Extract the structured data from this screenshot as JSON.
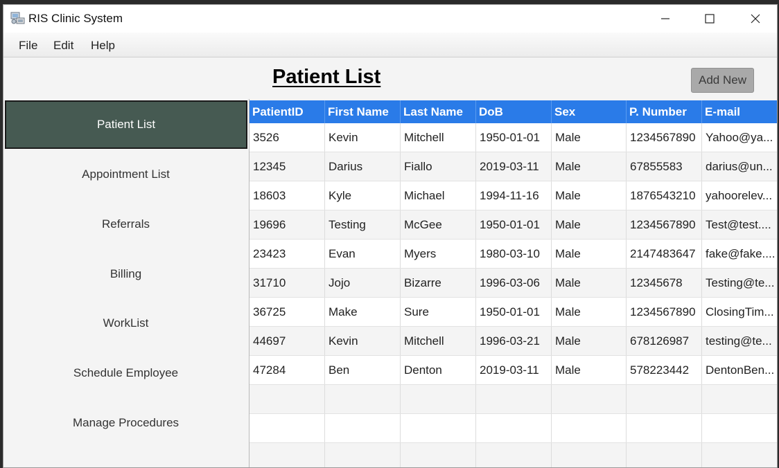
{
  "window": {
    "title": "RIS Clinic System",
    "icon": "clinic-app-icon"
  },
  "menu": {
    "file": "File",
    "edit": "Edit",
    "help": "Help"
  },
  "header": {
    "title": "Patient List",
    "add_new_label": "Add New"
  },
  "sidebar": {
    "items": [
      {
        "label": "Patient List",
        "active": true
      },
      {
        "label": "Appointment List",
        "active": false
      },
      {
        "label": "Referrals",
        "active": false
      },
      {
        "label": "Billing",
        "active": false
      },
      {
        "label": "WorkList",
        "active": false
      },
      {
        "label": "Schedule Employee",
        "active": false
      },
      {
        "label": "Manage Procedures",
        "active": false
      }
    ]
  },
  "table": {
    "columns": [
      "PatientID",
      "First Name",
      "Last Name",
      "DoB",
      "Sex",
      "P. Number",
      "E-mail"
    ],
    "rows": [
      [
        "3526",
        "Kevin",
        "Mitchell",
        "1950-01-01",
        "Male",
        "1234567890",
        "Yahoo@ya..."
      ],
      [
        "12345",
        "Darius",
        "Fiallo",
        "2019-03-11",
        "Male",
        "67855583",
        "darius@un..."
      ],
      [
        "18603",
        "Kyle",
        "Michael",
        "1994-11-16",
        "Male",
        "1876543210",
        "yahoorelev..."
      ],
      [
        "19696",
        "Testing",
        "McGee",
        "1950-01-01",
        "Male",
        "1234567890",
        "Test@test...."
      ],
      [
        "23423",
        "Evan",
        "Myers",
        "1980-03-10",
        "Male",
        "2147483647",
        "fake@fake...."
      ],
      [
        "31710",
        "Jojo",
        "Bizarre",
        "1996-03-06",
        "Male",
        "12345678",
        "Testing@te..."
      ],
      [
        "36725",
        "Make",
        "Sure",
        "1950-01-01",
        "Male",
        "1234567890",
        "ClosingTim..."
      ],
      [
        "44697",
        "Kevin",
        "Mitchell",
        "1996-03-21",
        "Male",
        "678126987",
        "testing@te..."
      ],
      [
        "47284",
        "Ben",
        "Denton",
        "2019-03-11",
        "Male",
        "578223442",
        "DentonBen..."
      ]
    ],
    "empty_rows": 3
  },
  "colors": {
    "header_blue": "#2a7be8",
    "active_sidebar": "#465a52",
    "button_gray": "#a9a9a9"
  }
}
